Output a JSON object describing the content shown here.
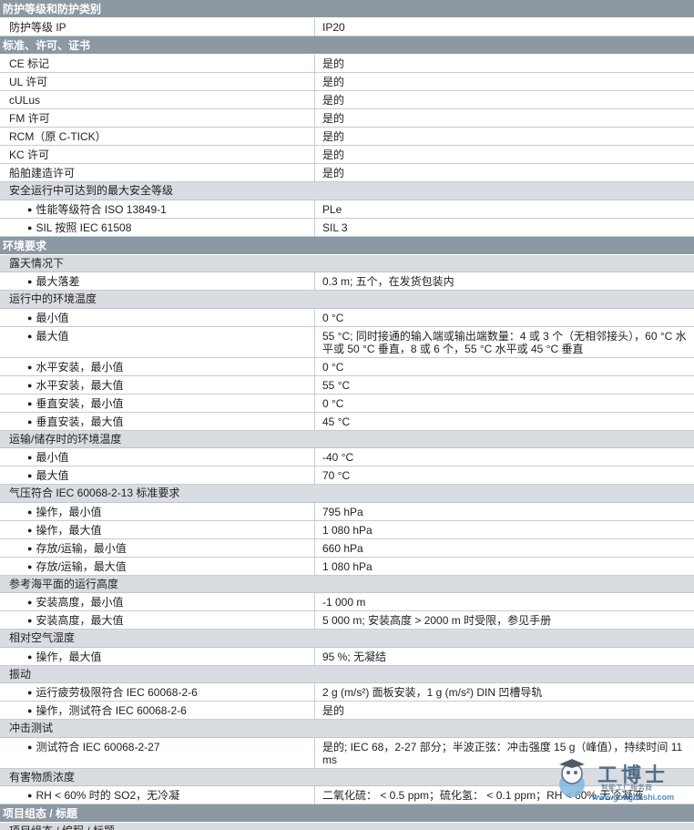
{
  "sections": [
    {
      "title": "防护等级和防护类别",
      "items": [
        {
          "kind": "row",
          "label": "防护等级 IP",
          "value": "IP20"
        }
      ]
    },
    {
      "title": "标准、许可、证书",
      "items": [
        {
          "kind": "row",
          "label": "CE 标记",
          "value": "是的"
        },
        {
          "kind": "row",
          "label": "UL 许可",
          "value": "是的"
        },
        {
          "kind": "row",
          "label": "cULus",
          "value": "是的"
        },
        {
          "kind": "row",
          "label": "FM 许可",
          "value": "是的"
        },
        {
          "kind": "row",
          "label": "RCM（原 C-TICK）",
          "value": "是的"
        },
        {
          "kind": "row",
          "label": "KC 许可",
          "value": "是的"
        },
        {
          "kind": "row",
          "label": "船舶建造许可",
          "value": "是的"
        },
        {
          "kind": "group",
          "label": "安全运行中可达到的最大安全等级"
        },
        {
          "kind": "sub",
          "label": "性能等级符合 ISO 13849-1",
          "value": "PLe"
        },
        {
          "kind": "sub",
          "label": "SIL 按照 IEC 61508",
          "value": "SIL 3"
        }
      ]
    },
    {
      "title": "环境要求",
      "items": [
        {
          "kind": "group",
          "label": "露天情况下"
        },
        {
          "kind": "sub",
          "label": "最大落差",
          "value": "0.3 m; 五个，在发货包装内"
        },
        {
          "kind": "group",
          "label": "运行中的环境温度"
        },
        {
          "kind": "sub",
          "label": "最小值",
          "value": "0 °C"
        },
        {
          "kind": "sub",
          "label": "最大值",
          "value": "55 °C; 同时接通的输入端或输出端数量：4 或 3 个（无相邻接头），60 °C 水平或 50 °C 垂直，8 或 6 个，55 °C 水平或 45 °C 垂直"
        },
        {
          "kind": "sub",
          "label": "水平安装，最小值",
          "value": "0 °C"
        },
        {
          "kind": "sub",
          "label": "水平安装，最大值",
          "value": "55 °C"
        },
        {
          "kind": "sub",
          "label": "垂直安装，最小值",
          "value": "0 °C"
        },
        {
          "kind": "sub",
          "label": "垂直安装，最大值",
          "value": "45 °C"
        },
        {
          "kind": "group",
          "label": "运输/储存时的环境温度"
        },
        {
          "kind": "sub",
          "label": "最小值",
          "value": "-40 °C"
        },
        {
          "kind": "sub",
          "label": "最大值",
          "value": "70 °C"
        },
        {
          "kind": "group",
          "label": "气压符合 IEC 60068-2-13 标准要求"
        },
        {
          "kind": "sub",
          "label": "操作，最小值",
          "value": "795 hPa"
        },
        {
          "kind": "sub",
          "label": "操作，最大值",
          "value": "1 080 hPa"
        },
        {
          "kind": "sub",
          "label": "存放/运输，最小值",
          "value": "660 hPa"
        },
        {
          "kind": "sub",
          "label": "存放/运输，最大值",
          "value": "1 080 hPa"
        },
        {
          "kind": "group",
          "label": "参考海平面的运行高度"
        },
        {
          "kind": "sub",
          "label": "安装高度，最小值",
          "value": "-1 000 m"
        },
        {
          "kind": "sub",
          "label": "安装高度，最大值",
          "value": "5 000 m; 安装高度 > 2000 m 时受限，参见手册"
        },
        {
          "kind": "group",
          "label": "相对空气湿度"
        },
        {
          "kind": "sub",
          "label": "操作，最大值",
          "value": "95 %; 无凝结"
        },
        {
          "kind": "group",
          "label": "振动"
        },
        {
          "kind": "sub",
          "label": "运行疲劳极限符合 IEC 60068-2-6",
          "value": "2 g (m/s²) 面板安装，1 g (m/s²) DIN 凹槽导轨"
        },
        {
          "kind": "sub",
          "label": "操作，测试符合 IEC 60068-2-6",
          "value": "是的"
        },
        {
          "kind": "group",
          "label": "冲击测试"
        },
        {
          "kind": "sub",
          "label": "测试符合 IEC 60068-2-27",
          "value": "是的; IEC 68，2-27 部分；半波正弦：冲击强度 15 g（峰值），持续时间 11 ms"
        },
        {
          "kind": "group",
          "label": "有害物质浓度"
        },
        {
          "kind": "sub",
          "label": "RH < 60% 时的 SO2，无冷凝",
          "value": "二氧化硫： < 0.5 ppm；硫化氢： < 0.1 ppm；RH < 60% 无冷凝液"
        }
      ]
    },
    {
      "title": "项目组态 / 标题",
      "items": [
        {
          "kind": "group",
          "label": "项目组态 / 编程 / 标题"
        }
      ]
    }
  ],
  "bullet_glyph": "●",
  "watermark": {
    "brand": "工博士",
    "tagline": "智能工厂服务商",
    "url": "www.gongboshi.com"
  }
}
